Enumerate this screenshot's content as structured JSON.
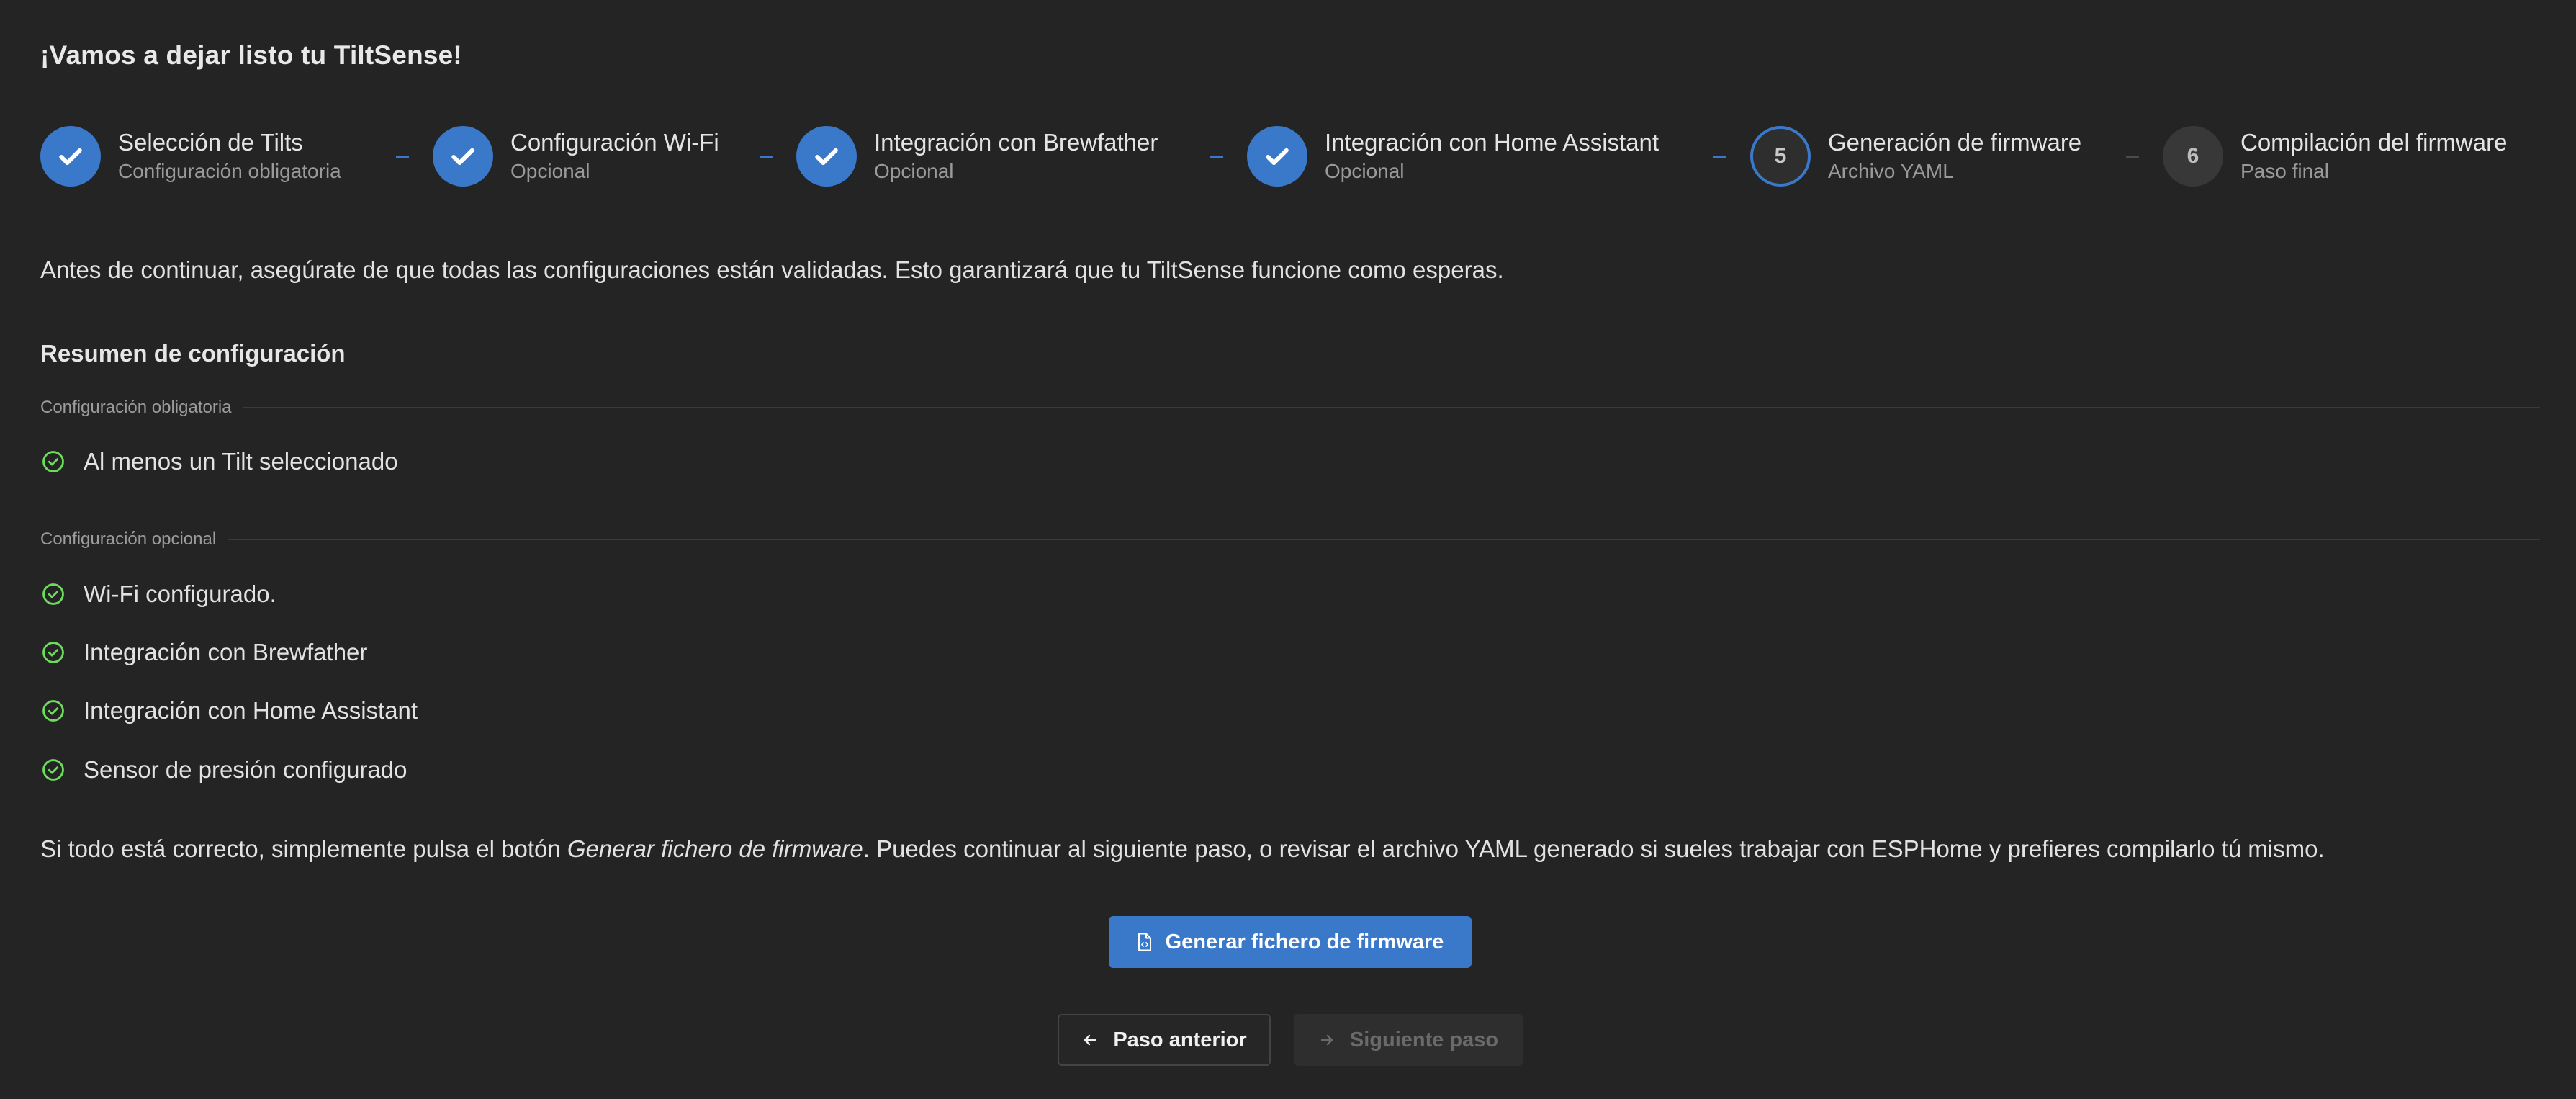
{
  "page": {
    "title": "¡Vamos a dejar listo tu TiltSense!"
  },
  "stepper": {
    "steps": [
      {
        "number": "1",
        "label": "Selección de Tilts",
        "description": "Configuración obligatoria",
        "state": "completed"
      },
      {
        "number": "2",
        "label": "Configuración Wi-Fi",
        "description": "Opcional",
        "state": "completed"
      },
      {
        "number": "3",
        "label": "Integración con Brewfather",
        "description": "Opcional",
        "state": "completed"
      },
      {
        "number": "4",
        "label": "Integración con Home Assistant",
        "description": "Opcional",
        "state": "completed"
      },
      {
        "number": "5",
        "label": "Generación de firmware",
        "description": "Archivo YAML",
        "state": "active"
      },
      {
        "number": "6",
        "label": "Compilación del firmware",
        "description": "Paso final",
        "state": "pending"
      }
    ]
  },
  "main": {
    "intro": "Antes de continuar, asegúrate de que todas las configuraciones están validadas. Esto garantizará que tu TiltSense funcione como esperas.",
    "summary_title": "Resumen de configuración",
    "mandatory": {
      "label": "Configuración obligatoria",
      "items": [
        "Al menos un Tilt seleccionado"
      ]
    },
    "optional": {
      "label": "Configuración opcional",
      "items": [
        "Wi-Fi configurado.",
        "Integración con Brewfather",
        "Integración con Home Assistant",
        "Sensor de presión configurado"
      ]
    },
    "outro": {
      "before": "Si todo está correcto, simplemente pulsa el botón ",
      "emphasis": "Generar fichero de firmware",
      "after": ". Puedes continuar al siguiente paso, o revisar el archivo YAML generado si sueles trabajar con ESPHome y prefieres compilarlo tú mismo."
    }
  },
  "actions": {
    "generate_label": "Generar fichero de firmware",
    "prev_label": "Paso anterior",
    "next_label": "Siguiente paso"
  },
  "colors": {
    "accent": "#3a78c9",
    "success": "#6ddc5a",
    "background": "#242424"
  }
}
